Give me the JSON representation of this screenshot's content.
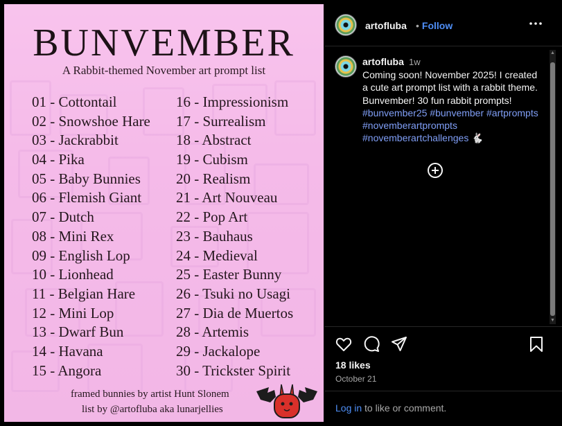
{
  "poster": {
    "title": "BUNVEMBER",
    "subtitle": "A Rabbit-themed November art prompt list",
    "prompts_left": [
      "01 - Cottontail",
      "02 - Snowshoe Hare",
      "03 - Jackrabbit",
      "04 - Pika",
      "05 - Baby Bunnies",
      "06 - Flemish Giant",
      "07 - Dutch",
      "08 - Mini Rex",
      "09 - English Lop",
      "10 - Lionhead",
      "11 - Belgian Hare",
      "12 - Mini Lop",
      "13 - Dwarf Bun",
      "14 - Havana",
      "15 - Angora"
    ],
    "prompts_right": [
      "16 - Impressionism",
      "17 - Surrealism",
      "18 - Abstract",
      "19 - Cubism",
      "20 - Realism",
      "21 - Art Nouveau",
      "22 - Pop Art",
      "23 - Bauhaus",
      "24 - Medieval",
      "25 - Easter Bunny",
      "26 - Tsuki no Usagi",
      "27 - Dia de Muertos",
      "28 - Artemis",
      "29 - Jackalope",
      "30 - Trickster Spirit"
    ],
    "credit_1": "framed bunnies by artist Hunt Slonem",
    "credit_2": "list by @artofluba aka lunarjellies"
  },
  "header": {
    "username": "artofluba",
    "dot": "•",
    "follow_label": "Follow"
  },
  "caption": {
    "username": "artofluba",
    "time": "1w",
    "text": "Coming soon! November 2025! I created a cute art prompt list with a rabbit theme. Bunvember! 30 fun rabbit prompts!",
    "hashtags": [
      "#bunvember25",
      "#bunvember",
      "#artprompts",
      "#novemberartprompts",
      "#novemberartchallenges"
    ],
    "emoji": "🐇"
  },
  "engagement": {
    "likes": "18 likes",
    "date": "October 21"
  },
  "login": {
    "link": "Log in",
    "rest": " to like or comment."
  },
  "icons": {
    "more": "more-options-icon",
    "add_comment": "plus-circle-icon",
    "like": "heart-icon",
    "comment": "speech-bubble-icon",
    "share": "paper-plane-icon",
    "save": "bookmark-icon"
  },
  "colors": {
    "link_blue": "#4f8ff7",
    "hashtag_blue": "#809ff7",
    "poster_pink": "#f6bde9"
  }
}
